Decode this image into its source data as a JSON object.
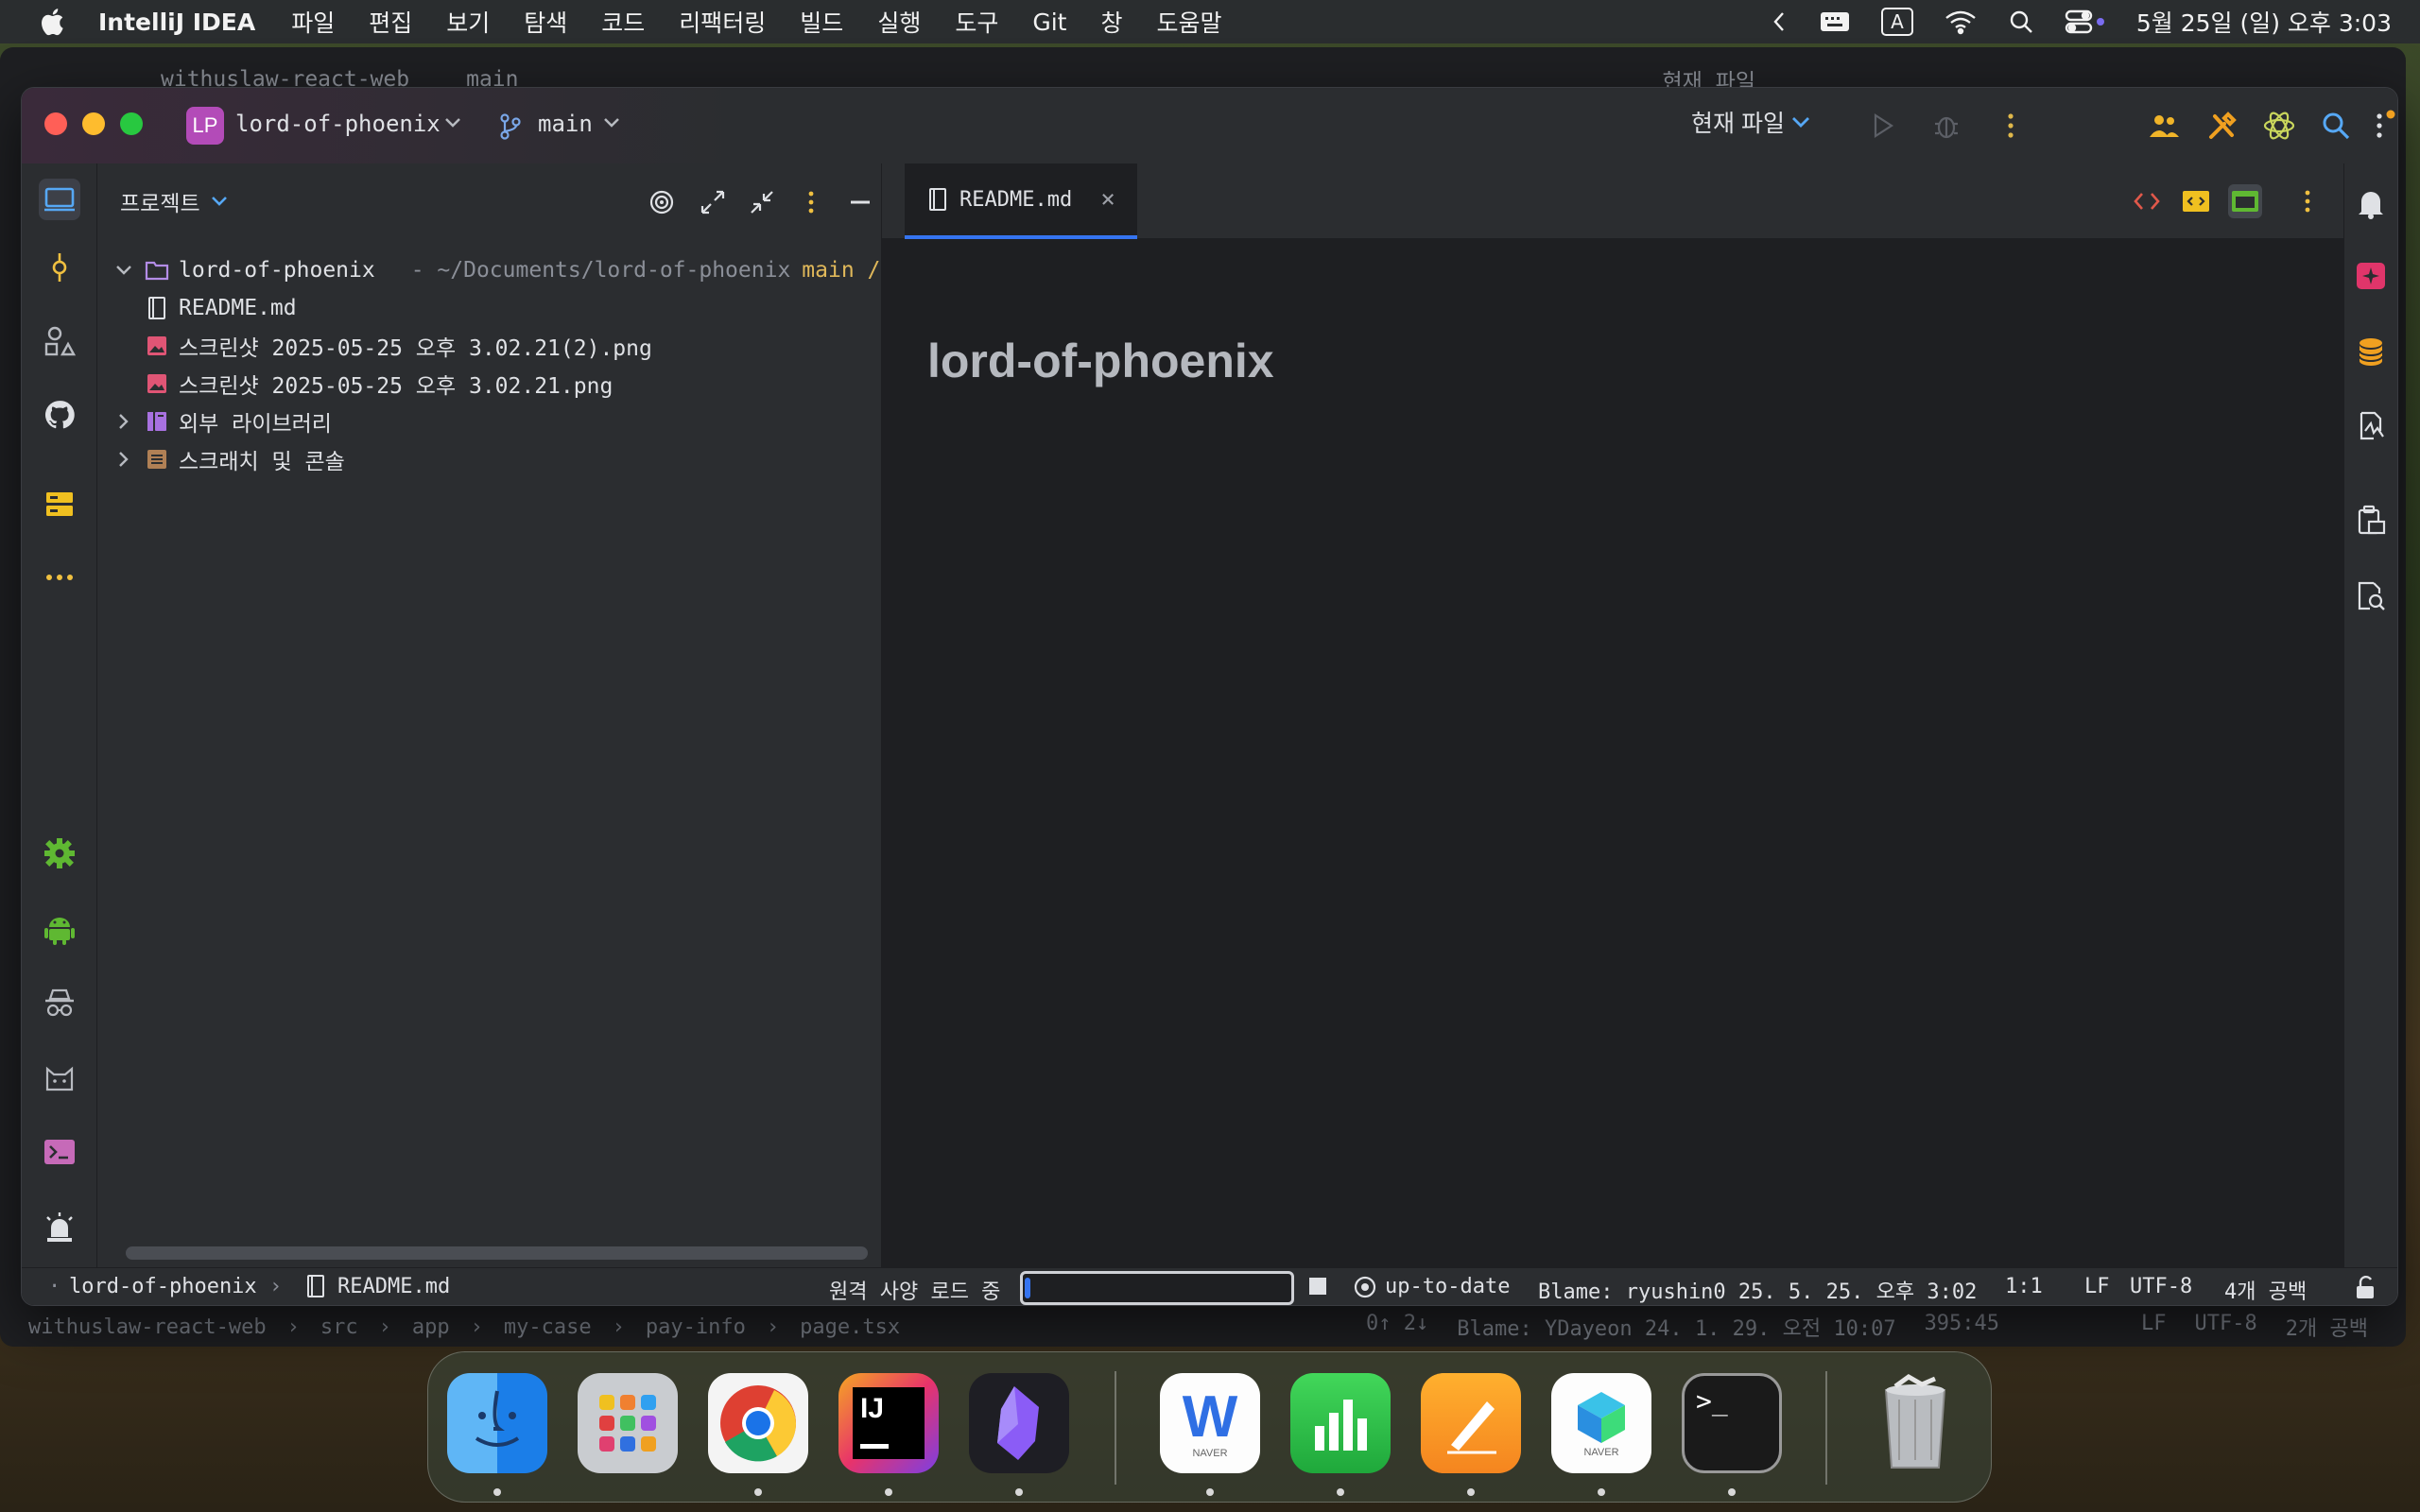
{
  "menubar": {
    "app_name": "IntelliJ IDEA",
    "items": [
      "파일",
      "편집",
      "보기",
      "탐색",
      "코드",
      "리팩터링",
      "빌드",
      "실행",
      "도구",
      "Git",
      "창",
      "도움말"
    ],
    "input_source": "A",
    "clock": "5월 25일 (일) 오후 3:03"
  },
  "bg_window": {
    "project": "withuslaw-react-web",
    "branch": "main",
    "run_config": "현재 파일",
    "breadcrumbs": [
      "withuslaw-react-web",
      "src",
      "app",
      "my-case",
      "pay-info",
      "page.tsx"
    ],
    "sync": "0↑ 2↓",
    "blame": "Blame: YDayeon 24. 1. 29. 오전 10:07",
    "position": "395:45",
    "line_sep": "LF",
    "encoding": "UTF-8",
    "indent": "2개 공백"
  },
  "titlebar": {
    "project_badge": "LP",
    "project_name": "lord-of-phoenix",
    "branch": "main",
    "run_config": "현재 파일",
    "accent_color": "#b34bb8"
  },
  "project_panel": {
    "title": "프로젝트",
    "tree": [
      {
        "label": "lord-of-phoenix",
        "path": "- ~/Documents/lord-of-phoenix",
        "branch": "main / ⊘",
        "expanded": true
      },
      {
        "label": "README.md"
      },
      {
        "label": "스크린샷 2025-05-25 오후 3.02.21(2).png"
      },
      {
        "label": "스크린샷 2025-05-25 오후 3.02.21.png"
      },
      {
        "label": "외부 라이브러리"
      },
      {
        "label": "스크래치 및 콘솔"
      }
    ]
  },
  "editor": {
    "tab_label": "README.md",
    "heading": "lord-of-phoenix"
  },
  "statusbar": {
    "crumb_project": "lord-of-phoenix",
    "crumb_file": "README.md",
    "loading_text": "원격 사양 로드 중",
    "progress": 0.02,
    "vcs_status": "up-to-date",
    "blame": "Blame: ryushin0 25. 5. 25. 오후 3:02",
    "position": "1:1",
    "line_sep": "LF",
    "encoding": "UTF-8",
    "indent": "4개 공백"
  },
  "dock": {
    "apps": [
      "finder",
      "launchpad",
      "chrome",
      "intellij-idea",
      "obsidian",
      "naver-whale",
      "numbers",
      "pages",
      "naver-cube",
      "terminal",
      "trash"
    ],
    "whale_caption": "NAVER",
    "cube_caption": "NAVER",
    "terminal_prompt": ">_"
  }
}
